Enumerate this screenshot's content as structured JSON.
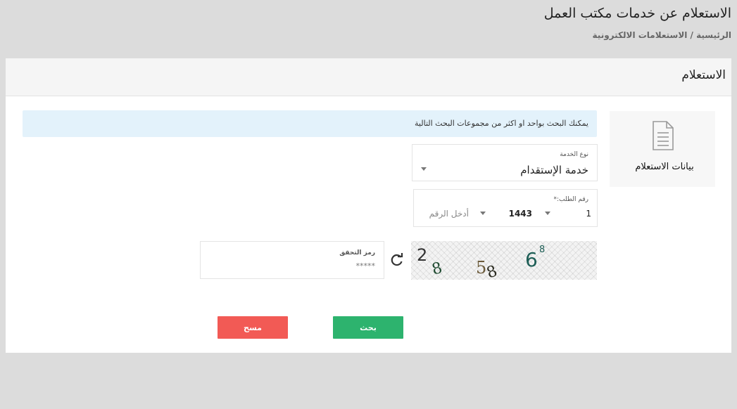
{
  "header": {
    "title": "الاستعلام عن خدمات مكتب العمل",
    "breadcrumb": "الرئيسية / الاستعلامات الالكترونية"
  },
  "panel": {
    "title": "الاستعلام"
  },
  "sidebar": {
    "tab_label": "بيانات الاستعلام",
    "tab_icon": "document-icon"
  },
  "info": {
    "line1": "يمكنك البحث بواحد او اكثر من مجموعات البحث التالية"
  },
  "form": {
    "service": {
      "label": "نوع الخدمة",
      "value": "خدمة الإستقدام"
    },
    "request": {
      "label": "رقم الطلب:*",
      "part1": "1",
      "part2": "1443",
      "placeholder": "أدخل الرقم"
    },
    "captcha": {
      "text": "2 8 5 8 6 8"
    },
    "code": {
      "label": "رمز التحقق",
      "placeholder": "*****"
    }
  },
  "buttons": {
    "search": "بحث",
    "clear": "مسح"
  },
  "colors": {
    "search": "#2db36e",
    "clear": "#f25a55",
    "info_bg": "#e3f2fb"
  }
}
